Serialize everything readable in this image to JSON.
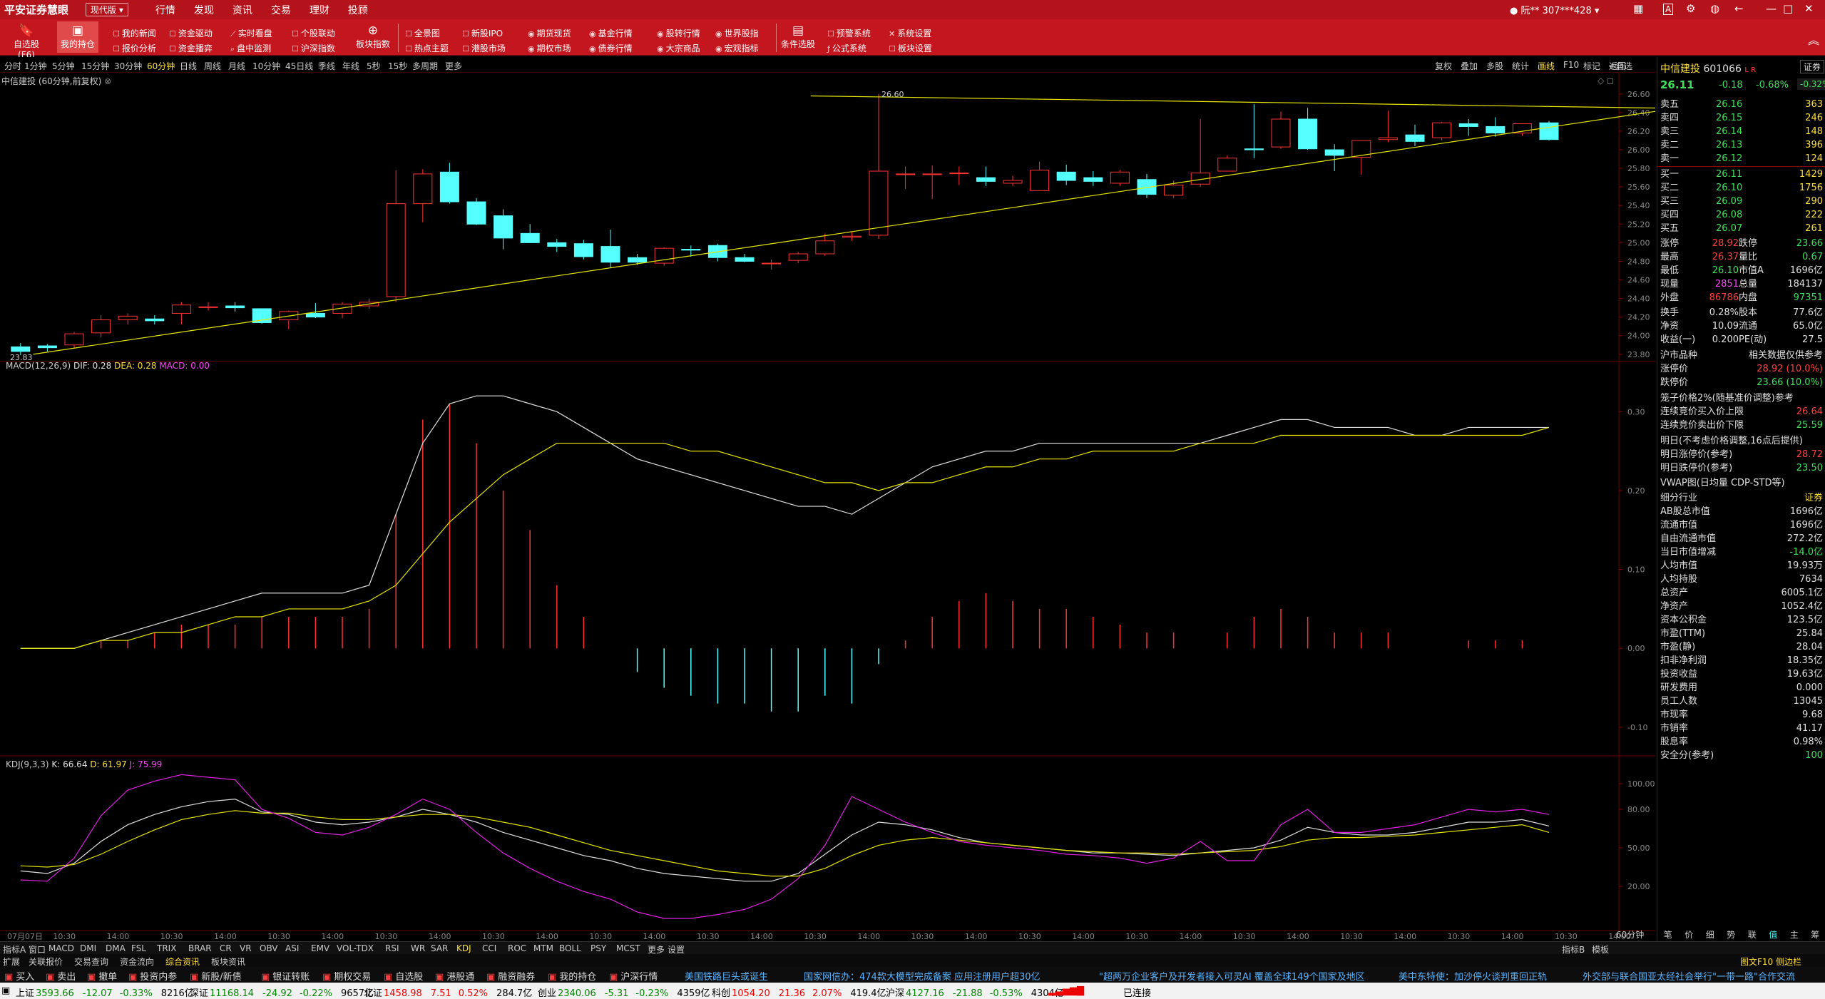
{
  "app": {
    "name": "平安证券慧眼",
    "version": "现代版",
    "menus": [
      "行情",
      "发现",
      "资讯",
      "交易",
      "理财",
      "投顾"
    ],
    "user": "阮**  307***428"
  },
  "toolbar": {
    "big": [
      {
        "label": "自选股(F6)",
        "icon": "bookmark-icon"
      },
      {
        "label": "我的持仓",
        "icon": "briefcase-icon"
      }
    ],
    "col1": [
      "我的新闻",
      "报价分析"
    ],
    "col2": [
      "资金驱动",
      "资金播弈"
    ],
    "col3": [
      "实时看盘",
      "盘中监测"
    ],
    "col4": [
      "个股联动",
      "沪深指数"
    ],
    "sector": "板块指数",
    "col5": [
      "全景图",
      "热点主题"
    ],
    "col6": [
      "新股IPO",
      "港股市场"
    ],
    "col7": [
      "期货现货",
      "期权市场"
    ],
    "col8": [
      "基金行情",
      "债券行情"
    ],
    "col9": [
      "股转行情",
      "大宗商品"
    ],
    "col10": [
      "世界股指",
      "宏观指标"
    ],
    "cond": "条件选股",
    "col11": [
      "预警系统",
      "公式系统"
    ],
    "col12": [
      "系统设置",
      "板块设置"
    ]
  },
  "periods": [
    "分时",
    "1分钟",
    "5分钟",
    "15分钟",
    "30分钟",
    "60分钟",
    "日线",
    "周线",
    "月线",
    "10分钟",
    "45日线",
    "季线",
    "年线",
    "5秒",
    "15秒",
    "多周期",
    "更多"
  ],
  "active_period": "60分钟",
  "right_tools": [
    "复权",
    "叠加",
    "多股",
    "统计",
    "画线",
    "F10",
    "标记",
    "返回"
  ],
  "active_tool": "画线",
  "chart": {
    "title": "中信建投 (60分钟,前复权)",
    "high_label": "26.60",
    "low_label": "23.83",
    "price_ticks": [
      "26.60",
      "26.40",
      "26.20",
      "26.00",
      "25.80",
      "25.60",
      "25.40",
      "25.20",
      "25.00",
      "24.80",
      "24.60",
      "24.40",
      "24.20",
      "24.00",
      "23.80"
    ],
    "macd_label": "MACD(12,26,9)",
    "dif": "DIF: 0.28",
    "dea": "DEA: 0.28",
    "macd": "MACD: 0.00",
    "macd_ticks": [
      "0.30",
      "0.20",
      "0.10",
      "0.00",
      "-0.10"
    ],
    "kdj_label": "KDJ(9,3,3)",
    "k": "K: 66.64",
    "d": "D: 61.97",
    "j": "J: 75.99",
    "kdj_ticks": [
      "100.00",
      "80.00",
      "50.00",
      "20.00"
    ],
    "time_labels": [
      "07月07日",
      "10:30",
      "14:00",
      "10:30",
      "14:00",
      "10:30",
      "14:00",
      "10:30",
      "14:00",
      "10:30",
      "14:00",
      "10:30",
      "14:00",
      "10:30",
      "14:00",
      "10:30",
      "14:00",
      "10:30",
      "14:00",
      "10:30",
      "14:00",
      "10:30",
      "14:00",
      "10:30",
      "14:00",
      "10:30",
      "14:00",
      "10:30",
      "14:00",
      "10:30",
      "14:00"
    ],
    "period_badge": "60分钟"
  },
  "chart_data": {
    "type": "candlestick",
    "title": "中信建投 (60分钟,前复权)",
    "ohlc": [
      [
        23.88,
        23.92,
        23.79,
        23.83
      ],
      [
        23.89,
        23.91,
        23.83,
        23.87
      ],
      [
        23.9,
        24.04,
        23.86,
        24.02
      ],
      [
        24.03,
        24.22,
        23.98,
        24.17
      ],
      [
        24.17,
        24.24,
        24.12,
        24.21
      ],
      [
        24.18,
        24.22,
        24.12,
        24.16
      ],
      [
        24.24,
        24.36,
        24.12,
        24.33
      ],
      [
        24.31,
        24.36,
        24.27,
        24.31
      ],
      [
        24.32,
        24.36,
        24.26,
        24.3
      ],
      [
        24.29,
        24.29,
        24.13,
        24.14
      ],
      [
        24.17,
        24.27,
        24.07,
        24.26
      ],
      [
        24.24,
        24.35,
        24.19,
        24.2
      ],
      [
        24.24,
        24.36,
        24.19,
        24.34
      ],
      [
        24.32,
        24.4,
        24.29,
        24.36
      ],
      [
        24.42,
        25.78,
        24.36,
        25.42
      ],
      [
        25.42,
        25.79,
        25.22,
        25.74
      ],
      [
        25.76,
        25.86,
        25.42,
        25.44
      ],
      [
        25.44,
        25.48,
        25.19,
        25.2
      ],
      [
        25.29,
        25.36,
        24.93,
        25.05
      ],
      [
        25.1,
        25.2,
        25.0,
        25.0
      ],
      [
        25.0,
        25.04,
        24.9,
        24.96
      ],
      [
        24.99,
        25.03,
        24.82,
        24.85
      ],
      [
        24.96,
        25.14,
        24.73,
        24.79
      ],
      [
        24.84,
        24.88,
        24.76,
        24.79
      ],
      [
        24.78,
        24.95,
        24.75,
        24.94
      ],
      [
        24.93,
        24.97,
        24.85,
        24.92
      ],
      [
        24.97,
        24.99,
        24.8,
        24.84
      ],
      [
        24.84,
        24.88,
        24.79,
        24.8
      ],
      [
        24.78,
        24.82,
        24.71,
        24.78
      ],
      [
        24.81,
        24.9,
        24.78,
        24.88
      ],
      [
        24.88,
        25.1,
        24.86,
        25.02
      ],
      [
        25.06,
        25.12,
        25.02,
        25.07
      ],
      [
        25.08,
        26.6,
        25.04,
        25.77
      ],
      [
        25.74,
        25.82,
        25.58,
        25.74
      ],
      [
        25.74,
        25.83,
        25.47,
        25.74
      ],
      [
        25.75,
        25.82,
        25.62,
        25.75
      ],
      [
        25.7,
        25.82,
        25.61,
        25.66
      ],
      [
        25.64,
        25.72,
        25.61,
        25.67
      ],
      [
        25.56,
        25.87,
        25.56,
        25.78
      ],
      [
        25.76,
        25.84,
        25.62,
        25.67
      ],
      [
        25.7,
        25.77,
        25.61,
        25.66
      ],
      [
        25.64,
        25.78,
        25.61,
        25.76
      ],
      [
        25.68,
        25.74,
        25.48,
        25.52
      ],
      [
        25.51,
        25.67,
        25.48,
        25.62
      ],
      [
        25.63,
        26.33,
        25.6,
        25.75
      ],
      [
        25.77,
        25.94,
        25.77,
        25.91
      ],
      [
        26.01,
        26.49,
        25.91,
        26.0
      ],
      [
        26.03,
        26.41,
        26.01,
        26.33
      ],
      [
        26.33,
        26.45,
        26.0,
        26.01
      ],
      [
        26.0,
        26.06,
        25.77,
        25.94
      ],
      [
        25.92,
        26.06,
        25.73,
        26.1
      ],
      [
        26.11,
        26.42,
        26.08,
        26.13
      ],
      [
        26.16,
        26.27,
        26.04,
        26.09
      ],
      [
        26.13,
        26.3,
        26.1,
        26.29
      ],
      [
        26.28,
        26.33,
        26.15,
        26.25
      ],
      [
        26.25,
        26.35,
        26.14,
        26.18
      ],
      [
        26.18,
        26.28,
        26.15,
        26.28
      ],
      [
        26.29,
        26.31,
        26.1,
        26.11
      ]
    ],
    "trendlines": [
      {
        "from": [
          1,
          23.83
        ],
        "to": [
          58,
          26.4
        ],
        "color": "yellow"
      },
      {
        "from": [
          30,
          26.61
        ],
        "to": [
          58,
          26.4
        ],
        "color": "yellow"
      }
    ],
    "macd": {
      "dif": [
        0.0,
        0.0,
        0.0,
        0.01,
        0.02,
        0.03,
        0.04,
        0.05,
        0.06,
        0.07,
        0.07,
        0.07,
        0.07,
        0.08,
        0.17,
        0.26,
        0.31,
        0.32,
        0.32,
        0.31,
        0.3,
        0.28,
        0.26,
        0.24,
        0.23,
        0.22,
        0.21,
        0.2,
        0.19,
        0.18,
        0.18,
        0.17,
        0.19,
        0.21,
        0.23,
        0.24,
        0.25,
        0.25,
        0.26,
        0.26,
        0.26,
        0.26,
        0.26,
        0.26,
        0.26,
        0.27,
        0.28,
        0.29,
        0.29,
        0.28,
        0.28,
        0.28,
        0.27,
        0.27,
        0.28,
        0.28,
        0.28,
        0.28
      ],
      "dea": [
        0.0,
        0.0,
        0.0,
        0.01,
        0.01,
        0.02,
        0.02,
        0.03,
        0.04,
        0.04,
        0.05,
        0.05,
        0.05,
        0.06,
        0.08,
        0.12,
        0.16,
        0.19,
        0.22,
        0.24,
        0.26,
        0.26,
        0.26,
        0.26,
        0.26,
        0.25,
        0.25,
        0.24,
        0.23,
        0.22,
        0.21,
        0.21,
        0.2,
        0.21,
        0.21,
        0.22,
        0.23,
        0.23,
        0.24,
        0.24,
        0.25,
        0.25,
        0.25,
        0.25,
        0.26,
        0.26,
        0.26,
        0.27,
        0.27,
        0.27,
        0.27,
        0.27,
        0.27,
        0.27,
        0.27,
        0.27,
        0.27,
        0.28
      ],
      "hist": [
        0.0,
        0.0,
        0.0,
        0.01,
        0.01,
        0.02,
        0.03,
        0.03,
        0.03,
        0.04,
        0.04,
        0.04,
        0.04,
        0.05,
        0.17,
        0.29,
        0.31,
        0.26,
        0.2,
        0.15,
        0.08,
        0.04,
        0.0,
        -0.03,
        -0.05,
        -0.06,
        -0.07,
        -0.07,
        -0.08,
        -0.08,
        -0.06,
        -0.07,
        -0.02,
        0.01,
        0.04,
        0.06,
        0.07,
        0.06,
        0.05,
        0.05,
        0.04,
        0.03,
        0.02,
        0.02,
        0.0,
        0.02,
        0.04,
        0.05,
        0.04,
        0.02,
        0.02,
        0.02,
        0.0,
        0.0,
        0.01,
        0.01,
        0.01,
        0.0
      ]
    },
    "kdj": {
      "k": [
        32,
        30,
        38,
        55,
        68,
        76,
        82,
        86,
        88,
        78,
        76,
        70,
        68,
        70,
        74,
        80,
        76,
        70,
        62,
        56,
        50,
        44,
        40,
        34,
        30,
        28,
        26,
        24,
        24,
        30,
        45,
        60,
        70,
        68,
        64,
        58,
        54,
        52,
        50,
        48,
        46,
        46,
        45,
        44,
        46,
        48,
        50,
        56,
        66,
        62,
        60,
        60,
        62,
        66,
        70,
        70,
        72,
        67
      ],
      "d": [
        36,
        35,
        37,
        45,
        55,
        64,
        72,
        76,
        79,
        77,
        77,
        74,
        72,
        72,
        74,
        76,
        76,
        74,
        70,
        66,
        60,
        54,
        48,
        44,
        40,
        36,
        32,
        30,
        28,
        28,
        34,
        44,
        52,
        56,
        58,
        56,
        54,
        52,
        50,
        48,
        47,
        46,
        46,
        45,
        46,
        47,
        48,
        51,
        56,
        58,
        58,
        59,
        60,
        62,
        64,
        66,
        68,
        62
      ],
      "j": [
        25,
        24,
        42,
        75,
        95,
        102,
        107,
        105,
        103,
        80,
        73,
        62,
        60,
        66,
        76,
        88,
        80,
        62,
        46,
        34,
        24,
        16,
        10,
        0,
        -5,
        -5,
        -2,
        2,
        10,
        26,
        52,
        90,
        80,
        70,
        62,
        55,
        52,
        50,
        48,
        45,
        44,
        42,
        38,
        42,
        55,
        40,
        40,
        68,
        80,
        62,
        62,
        65,
        68,
        74,
        80,
        78,
        80,
        76
      ]
    }
  },
  "quote": {
    "name": "中信建投",
    "code": "601066",
    "tag": "L R",
    "industry": "证券",
    "price": "26.11",
    "change": "-0.18",
    "pct": "-0.68%",
    "sector_pct": "-0.32%",
    "asks": [
      {
        "l": "卖五",
        "p": "26.16",
        "v": "363"
      },
      {
        "l": "卖四",
        "p": "26.15",
        "v": "246"
      },
      {
        "l": "卖三",
        "p": "26.14",
        "v": "148"
      },
      {
        "l": "卖二",
        "p": "26.13",
        "v": "396"
      },
      {
        "l": "卖一",
        "p": "26.12",
        "v": "124"
      }
    ],
    "bids": [
      {
        "l": "买一",
        "p": "26.11",
        "v": "1429"
      },
      {
        "l": "买二",
        "p": "26.10",
        "v": "1756"
      },
      {
        "l": "买三",
        "p": "26.09",
        "v": "290"
      },
      {
        "l": "买四",
        "p": "26.08",
        "v": "222"
      },
      {
        "l": "买五",
        "p": "26.07",
        "v": "261"
      }
    ],
    "stats": [
      [
        "涨停",
        "28.92",
        "跌停",
        "23.66"
      ],
      [
        "最高",
        "26.37",
        "量比",
        "0.67"
      ],
      [
        "最低",
        "26.10",
        "市值A",
        "1696亿"
      ],
      [
        "现量",
        "2851",
        "总量",
        "184137"
      ],
      [
        "外盘",
        "86786",
        "内盘",
        "97351"
      ]
    ],
    "stats2": [
      [
        "换手",
        "0.28%",
        "股本",
        "77.6亿"
      ],
      [
        "净资",
        "10.09",
        "流通",
        "65.0亿"
      ],
      [
        "收益(一)",
        "0.200",
        "PE(动)",
        "27.5"
      ]
    ],
    "board": "沪市品种",
    "board_note": "相关数据仅供参考",
    "limit_up": "28.92 (10.0%)",
    "limit_down": "23.66 (10.0%)",
    "cage": "笼子价格2%(随基准价调整)参考",
    "cage_buy": "连续竞价买入价上限",
    "cage_buy_v": "26.64",
    "cage_sell": "连续竞价卖出价下限",
    "cage_sell_v": "25.59",
    "tomorrow": "明日(不考虑价格调整,16点后提供)",
    "t_up": "明日涨停价(参考)",
    "t_up_v": "28.72",
    "t_down": "明日跌停价(参考)",
    "t_down_v": "23.50",
    "vwap": "VWAP图(日均量 CDP-STD等)",
    "fund": [
      [
        "细分行业",
        "证券"
      ],
      [
        "AB股总市值",
        "1696亿"
      ],
      [
        "流通市值",
        "1696亿"
      ],
      [
        "自由流通市值",
        "272.2亿"
      ],
      [
        "当日市值增减",
        "-14.0亿"
      ],
      [
        "人均市值",
        "19.93万"
      ],
      [
        "人均持股",
        "7634"
      ],
      [
        "总资产",
        "6005.1亿"
      ],
      [
        "净资产",
        "1052.4亿"
      ],
      [
        "资本公积金",
        "123.5亿"
      ],
      [
        "市盈(TTM)",
        "25.84"
      ],
      [
        "市盈(静)",
        "28.04"
      ],
      [
        "扣非净利润",
        "18.35亿"
      ],
      [
        "投资收益",
        "19.63亿"
      ],
      [
        "研发费用",
        "0.000"
      ],
      [
        "员工人数",
        "13045"
      ],
      [
        "市现率",
        "9.68"
      ],
      [
        "市销率",
        "41.17"
      ],
      [
        "股息率",
        "0.98%"
      ],
      [
        "安全分(参考)",
        "100"
      ]
    ],
    "tabs": [
      "笔",
      "价",
      "细",
      "势",
      "联",
      "值",
      "主",
      "筹"
    ]
  },
  "bottom_tabs": [
    "指标A",
    "窗口",
    "MACD",
    "DMI",
    "DMA",
    "FSL",
    "TRIX",
    "BRAR",
    "CR",
    "VR",
    "OBV",
    "ASI",
    "EMV",
    "VOL-TDX",
    "RSI",
    "WR",
    "SAR",
    "KDJ",
    "CCI",
    "ROC",
    "MTM",
    "BOLL",
    "PSY",
    "MCST",
    "更多",
    "设置"
  ],
  "bottom_right": [
    "指标B",
    "模板"
  ],
  "info_tabs": [
    "扩展",
    "关联报价",
    "交易查询",
    "资金流向",
    "综合资讯",
    "板块资讯"
  ],
  "info_right": "图文F10 侧边栏",
  "actions": [
    "买入",
    "卖出",
    "撤单",
    "投资内参",
    "新股/新债",
    "银证转账",
    "期权交易",
    "自选股",
    "港股通",
    "融资融券",
    "我的持仓",
    "沪深行情"
  ],
  "news": [
    "美国铁路巨头或诞生",
    "国家网信办：474款大模型完成备案 应用注册用户超30亿",
    "\"超两万企业客户及开发者接入可灵AI 覆盖全球149个国家及地区",
    "美中东特使：加沙停火谈判重回正轨",
    "外交部与联合国亚太经社会举行\"一带一路\"合作交流"
  ],
  "indices": [
    {
      "name": "上证",
      "val": "3593.66",
      "chg": "-12.07",
      "pct": "-0.33%",
      "amt": "8216亿"
    },
    {
      "name": "深证",
      "val": "11168.14",
      "chg": "-24.92",
      "pct": "-0.22%",
      "amt": "9657亿"
    },
    {
      "name": "北证",
      "val": "1458.98",
      "chg": "7.51",
      "pct": "0.52%",
      "amt": "284.7亿"
    },
    {
      "name": "创业",
      "val": "2340.06",
      "chg": "-5.31",
      "pct": "-0.23%",
      "amt": "4359亿"
    },
    {
      "name": "科创",
      "val": "1054.20",
      "chg": "21.36",
      "pct": "2.07%",
      "amt": "419.4亿"
    },
    {
      "name": "沪深",
      "val": "4127.16",
      "chg": "-21.88",
      "pct": "-0.53%",
      "amt": "4304亿"
    }
  ],
  "status": "已连接"
}
